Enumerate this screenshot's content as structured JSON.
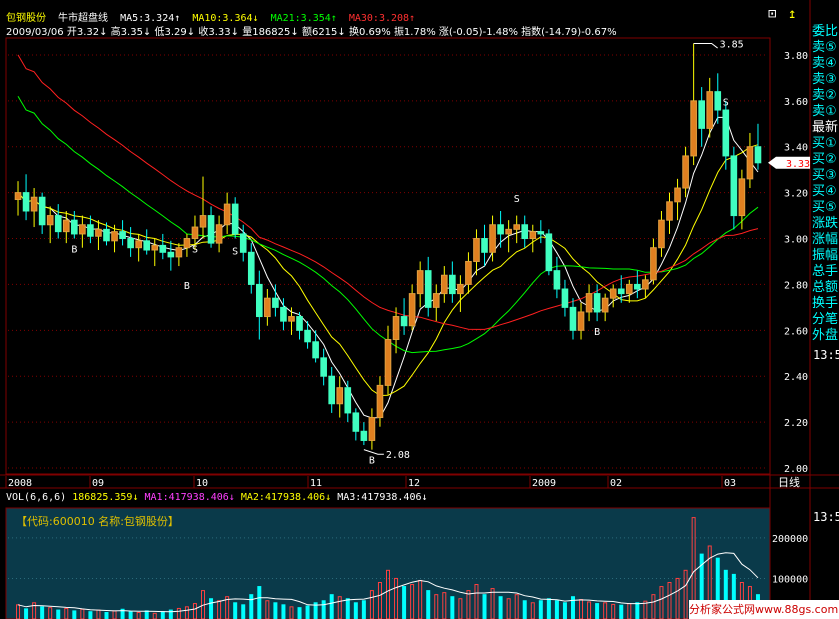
{
  "header": {
    "stock_name": "包钢股份",
    "indicator": "牛市超盘线",
    "ma5": "MA5:3.324↑",
    "ma10": "MA10:3.364↓",
    "ma21": "MA21:3.354↑",
    "ma30": "MA30:3.208↑",
    "close_box": "⊡",
    "date": "2009/03/06",
    "open": "开3.32↓",
    "high": "高3.35↓",
    "low": "低3.29↓",
    "close": "收3.33↓",
    "volume": "量186825↓",
    "amount": "额6215↓",
    "turnover": "换0.69%",
    "amplitude": "振1.78%",
    "change": "涨(-0.05)-1.48%",
    "index": "指数(-14.79)-0.67%"
  },
  "price_axis": {
    "ticks": [
      "3.80",
      "3.60",
      "3.40",
      "3.20",
      "3.00",
      "2.80",
      "2.60",
      "2.40",
      "2.20",
      "2.00"
    ],
    "current_price": "3.33"
  },
  "annotations": {
    "high_label": "3.85",
    "low_label": "2.08",
    "signals": [
      {
        "text": "B"
      },
      {
        "text": "S"
      },
      {
        "text": "B"
      },
      {
        "text": "S"
      },
      {
        "text": "B"
      },
      {
        "text": "S"
      },
      {
        "text": "B"
      },
      {
        "text": "S"
      }
    ]
  },
  "time_axis": {
    "labels": [
      "2008",
      "09",
      "10",
      "11",
      "12",
      "2009",
      "02",
      "03"
    ],
    "period": "日线"
  },
  "volume_panel": {
    "header_params": "VOL(6,6,6)",
    "vol_value": "186825.359↓",
    "ma1": "MA1:417938.406↓",
    "ma2": "MA2:417938.406↓",
    "ma3": "MA3:417938.406↓",
    "code_label": "【代码:600010 名称:包钢股份】",
    "ticks": [
      "200000",
      "100000"
    ]
  },
  "right_panel": {
    "items": [
      "委比",
      "卖⑤",
      "卖④",
      "卖③",
      "卖②",
      "卖①",
      "最新",
      "买①",
      "买②",
      "买③",
      "买④",
      "买⑤",
      "涨跌",
      "涨幅",
      "振幅",
      "总手",
      "总额",
      "换手",
      "分笔",
      "外盘"
    ],
    "time1": "13:5",
    "time2": "13:5"
  },
  "watermark": "分析家公式网www.88gs.com",
  "colors": {
    "up": "#ff4040",
    "down": "#00ffff",
    "ma5": "#ffffff",
    "ma10": "#ffff00",
    "ma21": "#00ff00",
    "ma30": "#ff2020",
    "grid": "#800000",
    "volume_bg": "#0a3a4a"
  },
  "chart_data": {
    "type": "candlestick",
    "ylim": [
      2.0,
      3.9
    ],
    "candles": [
      [
        3.17,
        3.25,
        3.1,
        3.2
      ],
      [
        3.2,
        3.28,
        3.08,
        3.12
      ],
      [
        3.12,
        3.22,
        3.05,
        3.18
      ],
      [
        3.18,
        3.2,
        3.02,
        3.06
      ],
      [
        3.06,
        3.14,
        2.98,
        3.1
      ],
      [
        3.1,
        3.15,
        3.0,
        3.03
      ],
      [
        3.03,
        3.12,
        2.98,
        3.08
      ],
      [
        3.08,
        3.12,
        3.0,
        3.02
      ],
      [
        3.02,
        3.1,
        2.96,
        3.06
      ],
      [
        3.06,
        3.1,
        2.98,
        3.01
      ],
      [
        3.01,
        3.08,
        2.95,
        3.04
      ],
      [
        3.04,
        3.07,
        2.97,
        2.99
      ],
      [
        2.99,
        3.06,
        2.94,
        3.03
      ],
      [
        3.03,
        3.08,
        2.97,
        3.0
      ],
      [
        3.0,
        3.05,
        2.92,
        2.96
      ],
      [
        2.96,
        3.02,
        2.9,
        2.99
      ],
      [
        2.99,
        3.04,
        2.93,
        2.95
      ],
      [
        2.95,
        3.0,
        2.88,
        2.97
      ],
      [
        2.97,
        3.02,
        2.91,
        2.94
      ],
      [
        2.94,
        2.99,
        2.86,
        2.92
      ],
      [
        2.92,
        2.98,
        2.88,
        2.96
      ],
      [
        2.96,
        3.02,
        2.92,
        3.0
      ],
      [
        3.0,
        3.1,
        2.95,
        3.05
      ],
      [
        3.05,
        3.27,
        3.0,
        3.1
      ],
      [
        3.1,
        3.14,
        2.96,
        2.98
      ],
      [
        2.98,
        3.1,
        2.94,
        3.06
      ],
      [
        3.06,
        3.2,
        3.02,
        3.15
      ],
      [
        3.15,
        3.18,
        3.0,
        3.02
      ],
      [
        3.02,
        3.06,
        2.9,
        2.94
      ],
      [
        2.94,
        2.98,
        2.76,
        2.8
      ],
      [
        2.8,
        2.86,
        2.56,
        2.66
      ],
      [
        2.66,
        2.78,
        2.62,
        2.74
      ],
      [
        2.74,
        2.8,
        2.66,
        2.7
      ],
      [
        2.7,
        2.74,
        2.6,
        2.64
      ],
      [
        2.64,
        2.7,
        2.58,
        2.66
      ],
      [
        2.66,
        2.68,
        2.56,
        2.6
      ],
      [
        2.6,
        2.64,
        2.52,
        2.55
      ],
      [
        2.55,
        2.6,
        2.46,
        2.48
      ],
      [
        2.48,
        2.52,
        2.36,
        2.4
      ],
      [
        2.4,
        2.44,
        2.24,
        2.28
      ],
      [
        2.28,
        2.4,
        2.22,
        2.35
      ],
      [
        2.35,
        2.38,
        2.2,
        2.24
      ],
      [
        2.24,
        2.26,
        2.12,
        2.16
      ],
      [
        2.16,
        2.2,
        2.1,
        2.12
      ],
      [
        2.12,
        2.26,
        2.08,
        2.22
      ],
      [
        2.22,
        2.4,
        2.18,
        2.36
      ],
      [
        2.36,
        2.62,
        2.32,
        2.56
      ],
      [
        2.56,
        2.7,
        2.5,
        2.66
      ],
      [
        2.66,
        2.74,
        2.58,
        2.62
      ],
      [
        2.62,
        2.8,
        2.6,
        2.76
      ],
      [
        2.76,
        2.9,
        2.7,
        2.86
      ],
      [
        2.86,
        2.92,
        2.66,
        2.7
      ],
      [
        2.7,
        2.8,
        2.64,
        2.76
      ],
      [
        2.76,
        2.88,
        2.72,
        2.84
      ],
      [
        2.84,
        2.9,
        2.72,
        2.76
      ],
      [
        2.76,
        2.84,
        2.68,
        2.8
      ],
      [
        2.8,
        2.94,
        2.76,
        2.9
      ],
      [
        2.9,
        3.04,
        2.84,
        3.0
      ],
      [
        3.0,
        3.06,
        2.88,
        2.94
      ],
      [
        2.94,
        3.1,
        2.9,
        3.06
      ],
      [
        3.06,
        3.12,
        2.96,
        3.02
      ],
      [
        3.02,
        3.08,
        2.94,
        3.04
      ],
      [
        3.04,
        3.1,
        2.98,
        3.06
      ],
      [
        3.06,
        3.1,
        2.96,
        3.0
      ],
      [
        3.0,
        3.06,
        2.94,
        3.03
      ],
      [
        3.03,
        3.08,
        2.98,
        3.02
      ],
      [
        3.02,
        3.04,
        2.84,
        2.86
      ],
      [
        2.86,
        2.92,
        2.74,
        2.78
      ],
      [
        2.78,
        2.82,
        2.66,
        2.7
      ],
      [
        2.7,
        2.74,
        2.56,
        2.6
      ],
      [
        2.6,
        2.72,
        2.56,
        2.68
      ],
      [
        2.68,
        2.8,
        2.64,
        2.76
      ],
      [
        2.76,
        2.8,
        2.64,
        2.68
      ],
      [
        2.68,
        2.76,
        2.64,
        2.74
      ],
      [
        2.74,
        2.8,
        2.7,
        2.78
      ],
      [
        2.78,
        2.84,
        2.72,
        2.76
      ],
      [
        2.76,
        2.82,
        2.72,
        2.8
      ],
      [
        2.8,
        2.86,
        2.74,
        2.78
      ],
      [
        2.78,
        2.84,
        2.74,
        2.82
      ],
      [
        2.82,
        3.0,
        2.8,
        2.96
      ],
      [
        2.96,
        3.12,
        2.92,
        3.08
      ],
      [
        3.08,
        3.2,
        3.02,
        3.16
      ],
      [
        3.16,
        3.26,
        3.08,
        3.22
      ],
      [
        3.22,
        3.4,
        3.18,
        3.36
      ],
      [
        3.36,
        3.85,
        3.32,
        3.6
      ],
      [
        3.6,
        3.66,
        3.4,
        3.48
      ],
      [
        3.48,
        3.7,
        3.44,
        3.64
      ],
      [
        3.64,
        3.72,
        3.5,
        3.56
      ],
      [
        3.56,
        3.6,
        3.3,
        3.36
      ],
      [
        3.36,
        3.4,
        3.04,
        3.1
      ],
      [
        3.1,
        3.3,
        3.04,
        3.26
      ],
      [
        3.26,
        3.46,
        3.22,
        3.4
      ],
      [
        3.4,
        3.5,
        3.3,
        3.33
      ]
    ],
    "volume": [
      35,
      25,
      40,
      30,
      28,
      22,
      26,
      20,
      24,
      18,
      22,
      16,
      20,
      24,
      18,
      16,
      20,
      14,
      18,
      22,
      26,
      30,
      38,
      70,
      50,
      45,
      55,
      40,
      35,
      60,
      80,
      45,
      40,
      35,
      30,
      28,
      32,
      40,
      45,
      60,
      55,
      50,
      40,
      45,
      70,
      90,
      120,
      100,
      80,
      85,
      95,
      70,
      60,
      65,
      55,
      50,
      70,
      85,
      60,
      75,
      55,
      50,
      60,
      45,
      40,
      45,
      50,
      45,
      40,
      55,
      48,
      42,
      38,
      40,
      36,
      34,
      38,
      40,
      44,
      60,
      80,
      90,
      100,
      120,
      250,
      160,
      180,
      150,
      120,
      110,
      90,
      80,
      60
    ]
  }
}
